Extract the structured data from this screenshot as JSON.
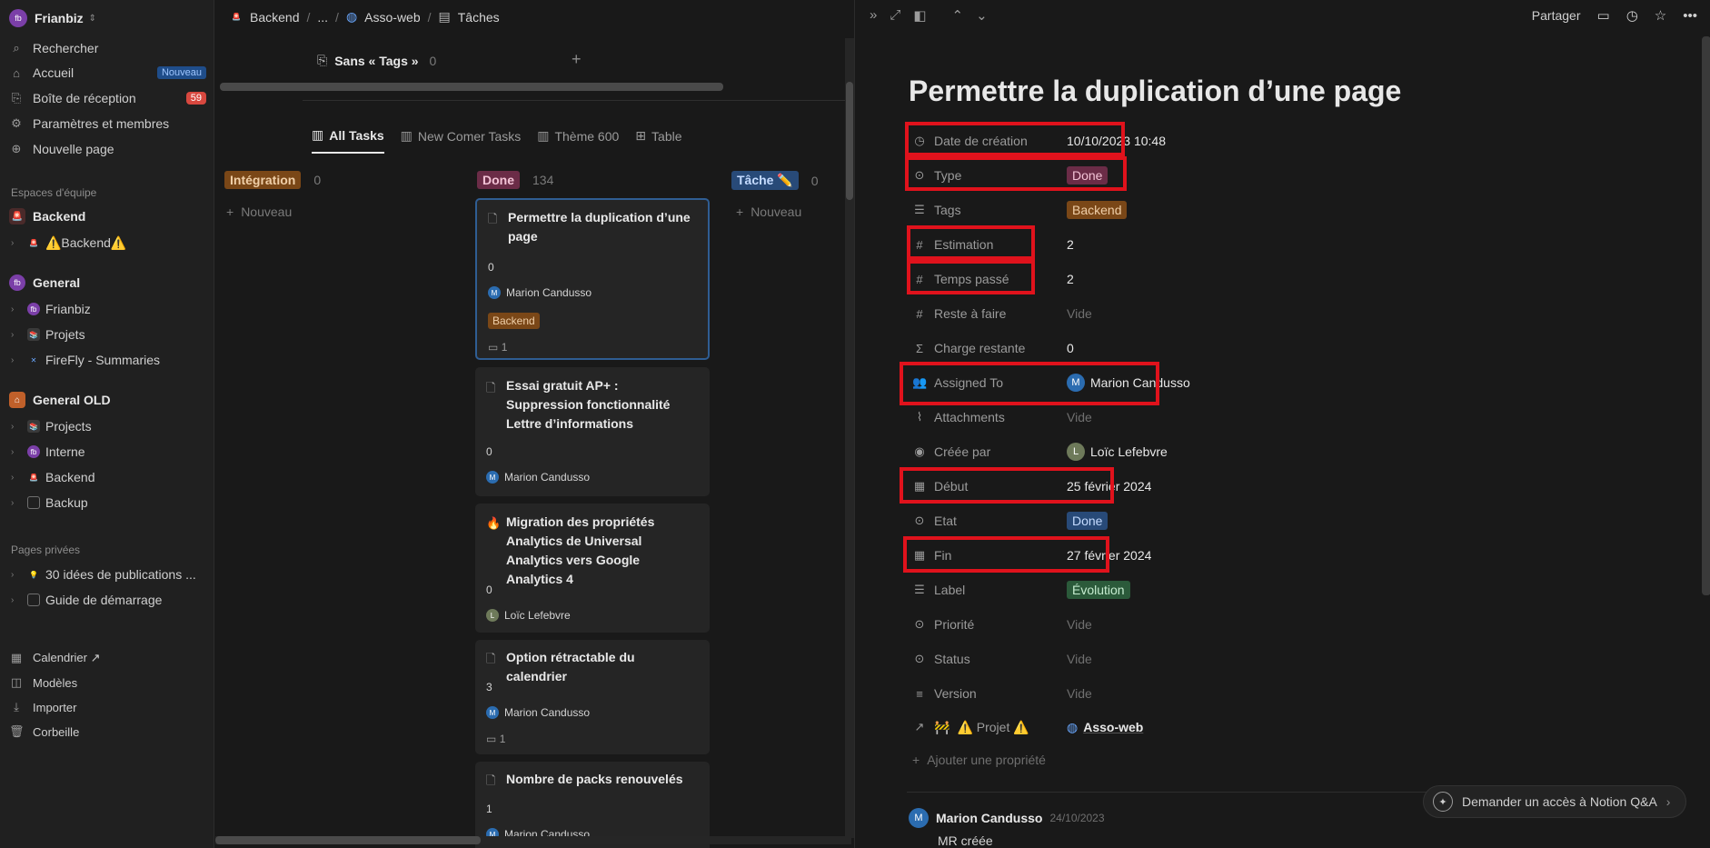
{
  "sidebar": {
    "workspace": "Frianbiz",
    "top_items": [
      {
        "label": "Rechercher",
        "icon": "search-icon"
      },
      {
        "label": "Accueil",
        "icon": "home-icon",
        "badge": "Nouveau"
      },
      {
        "label": "Boîte de réception",
        "icon": "inbox-icon",
        "badge": "59"
      },
      {
        "label": "Paramètres et membres",
        "icon": "gear-icon"
      },
      {
        "label": "Nouvelle page",
        "icon": "plus-circle-icon"
      }
    ],
    "team_spaces_header": "Espaces d'équipe",
    "backend_space": "Backend",
    "backend_child": "⚠️Backend⚠️",
    "general_space": "General",
    "general_children": [
      "Frianbiz",
      "Projets",
      "FireFly - Summaries"
    ],
    "general_old_space": "General OLD",
    "general_old_children": [
      "Projects",
      "Interne",
      "Backend",
      "Backup"
    ],
    "private_header": "Pages privées",
    "private_children": [
      "30 idées de publications ...",
      "Guide de démarrage"
    ],
    "bottom_items": [
      "Calendrier ↗",
      "Modèles",
      "Importer",
      "Corbeille"
    ]
  },
  "board": {
    "breadcrumb": [
      "Backend",
      "...",
      "Asso-web",
      "Tâches"
    ],
    "group_label": "Sans « Tags »",
    "group_count": "0",
    "tabs": [
      "All Tasks",
      "New Comer Tasks",
      "Thème 600",
      "Table"
    ],
    "columns": [
      {
        "name": "Intégration",
        "count": "0",
        "new_label": "Nouveau"
      },
      {
        "name": "Done",
        "count": "134"
      },
      {
        "name": "Tâche ✏️",
        "count": "0",
        "new_label": "Nouveau"
      }
    ],
    "cards": [
      {
        "title": "Permettre la duplication d’une page",
        "num": "0",
        "user": "Marion Candusso",
        "tag": "Backend",
        "comments": "1"
      },
      {
        "title": "Essai gratuit AP+ : Suppression fonctionnalité Lettre d’informations",
        "num": "0",
        "user": "Marion Candusso"
      },
      {
        "title": "Migration des propriétés Analytics de Universal Analytics vers Google Analytics 4",
        "num": "0",
        "user": "Loïc Lefebvre"
      },
      {
        "title": "Option rétractable du calendrier",
        "num": "3",
        "user": "Marion Candusso",
        "comments": "1"
      },
      {
        "title": "Nombre de packs renouvelés",
        "num": "1",
        "user": "Marion Candusso"
      }
    ]
  },
  "panel": {
    "share": "Partager",
    "title": "Permettre la duplication d’une page",
    "properties": [
      {
        "name": "Date de création",
        "value": "10/10/2023 10:48",
        "icon": "clock-icon"
      },
      {
        "name": "Type",
        "value": "Done",
        "icon": "select-icon"
      },
      {
        "name": "Tags",
        "value": "Backend",
        "icon": "list-icon"
      },
      {
        "name": "Estimation",
        "value": "2",
        "icon": "hash-icon"
      },
      {
        "name": "Temps passé",
        "value": "2",
        "icon": "hash-icon"
      },
      {
        "name": "Reste à faire",
        "value": "Vide",
        "icon": "hash-icon"
      },
      {
        "name": "Charge restante",
        "value": "0",
        "icon": "sigma-icon"
      },
      {
        "name": "Assigned To",
        "value": "Marion Candusso",
        "icon": "people-icon"
      },
      {
        "name": "Attachments",
        "value": "Vide",
        "icon": "paperclip-icon"
      },
      {
        "name": "Créée par",
        "value": "Loïc Lefebvre",
        "icon": "user-circle-icon"
      },
      {
        "name": "Début",
        "value": "25 février 2024",
        "icon": "calendar-icon"
      },
      {
        "name": "Etat",
        "value": "Done",
        "icon": "select-icon"
      },
      {
        "name": "Fin",
        "value": "27 février 2024",
        "icon": "calendar-icon"
      },
      {
        "name": "Label",
        "value": "Évolution",
        "icon": "list-icon"
      },
      {
        "name": "Priorité",
        "value": "Vide",
        "icon": "select-icon"
      },
      {
        "name": "Status",
        "value": "Vide",
        "icon": "select-icon"
      },
      {
        "name": "Version",
        "value": "Vide",
        "icon": "lines-icon"
      },
      {
        "name": "⚠️ Projet ⚠️",
        "value": "Asso-web",
        "icon": "relation-arrow-icon"
      }
    ],
    "add_property": "Ajouter une propriété",
    "comment_author": "Marion Candusso",
    "comment_date": "24/10/2023",
    "comment_text": "MR créée",
    "notion_qa": "Demander un accès à Notion Q&A"
  },
  "colors": {
    "highlight": "#e0121c",
    "done_pill": "#6b2c47",
    "backend_pill": "#7a4717",
    "etat_pill": "#284a78",
    "label_pill": "#2b5a3a"
  }
}
